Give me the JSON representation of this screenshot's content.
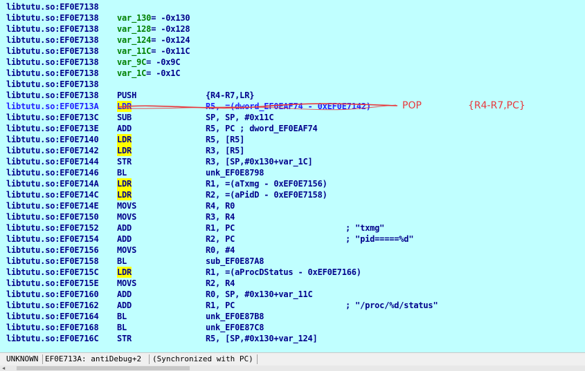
{
  "listing": {
    "rows": [
      {
        "kind": "plain",
        "addr": "libtutu.so:EF0E7138"
      },
      {
        "kind": "decl",
        "addr": "libtutu.so:EF0E7138",
        "var": "var_130",
        "val": "-0x130"
      },
      {
        "kind": "decl",
        "addr": "libtutu.so:EF0E7138",
        "var": "var_128",
        "val": "-0x128"
      },
      {
        "kind": "decl",
        "addr": "libtutu.so:EF0E7138",
        "var": "var_124",
        "val": "-0x124"
      },
      {
        "kind": "decl",
        "addr": "libtutu.so:EF0E7138",
        "var": "var_11C",
        "val": "-0x11C"
      },
      {
        "kind": "decl",
        "addr": "libtutu.so:EF0E7138",
        "var": "var_9C",
        "val": "-0x9C"
      },
      {
        "kind": "decl",
        "addr": "libtutu.so:EF0E7138",
        "var": "var_1C",
        "val": "-0x1C"
      },
      {
        "kind": "plain",
        "addr": "libtutu.so:EF0E7138"
      },
      {
        "kind": "ins",
        "addr": "libtutu.so:EF0E7138",
        "mn": "PUSH",
        "op": "{R4-R7,LR}"
      },
      {
        "kind": "ins",
        "addr": "libtutu.so:EF0E713A",
        "mn": "LDR",
        "op": "R5, =(dword_EF0EAF74 - 0xEF0E7142)",
        "current": true,
        "struck": true
      },
      {
        "kind": "ins",
        "addr": "libtutu.so:EF0E713C",
        "mn": "SUB",
        "op": "SP, SP, #0x11C"
      },
      {
        "kind": "ins",
        "addr": "libtutu.so:EF0E713E",
        "mn": "ADD",
        "op": "R5, PC ; dword_EF0EAF74"
      },
      {
        "kind": "ins",
        "addr": "libtutu.so:EF0E7140",
        "mn": "LDR",
        "op": "R5, [R5]"
      },
      {
        "kind": "ins",
        "addr": "libtutu.so:EF0E7142",
        "mn": "LDR",
        "op": "R3, [R5]"
      },
      {
        "kind": "ins",
        "addr": "libtutu.so:EF0E7144",
        "mn": "STR",
        "op": "R3, [SP,#0x130+var_1C]"
      },
      {
        "kind": "ins",
        "addr": "libtutu.so:EF0E7146",
        "mn": "BL",
        "op": "unk_EF0E8798"
      },
      {
        "kind": "ins",
        "addr": "libtutu.so:EF0E714A",
        "mn": "LDR",
        "op": "R1, =(aTxmg - 0xEF0E7156)"
      },
      {
        "kind": "ins",
        "addr": "libtutu.so:EF0E714C",
        "mn": "LDR",
        "op": "R2, =(aPidD - 0xEF0E7158)"
      },
      {
        "kind": "ins",
        "addr": "libtutu.so:EF0E714E",
        "mn": "MOVS",
        "op": "R4, R0"
      },
      {
        "kind": "ins",
        "addr": "libtutu.so:EF0E7150",
        "mn": "MOVS",
        "op": "R3, R4"
      },
      {
        "kind": "ins",
        "addr": "libtutu.so:EF0E7152",
        "mn": "ADD",
        "op": "R1, PC",
        "cm": "; \"txmg\""
      },
      {
        "kind": "ins",
        "addr": "libtutu.so:EF0E7154",
        "mn": "ADD",
        "op": "R2, PC",
        "cm": "; \"pid=====%d\""
      },
      {
        "kind": "ins",
        "addr": "libtutu.so:EF0E7156",
        "mn": "MOVS",
        "op": "R0, #4"
      },
      {
        "kind": "ins",
        "addr": "libtutu.so:EF0E7158",
        "mn": "BL",
        "op": "sub_EF0E87A8"
      },
      {
        "kind": "ins",
        "addr": "libtutu.so:EF0E715C",
        "mn": "LDR",
        "op": "R1, =(aProcDStatus - 0xEF0E7166)"
      },
      {
        "kind": "ins",
        "addr": "libtutu.so:EF0E715E",
        "mn": "MOVS",
        "op": "R2, R4"
      },
      {
        "kind": "ins",
        "addr": "libtutu.so:EF0E7160",
        "mn": "ADD",
        "op": "R0, SP, #0x130+var_11C"
      },
      {
        "kind": "ins",
        "addr": "libtutu.so:EF0E7162",
        "mn": "ADD",
        "op": "R1, PC",
        "cm": "; \"/proc/%d/status\""
      },
      {
        "kind": "ins",
        "addr": "libtutu.so:EF0E7164",
        "mn": "BL",
        "op": "unk_EF0E87B8"
      },
      {
        "kind": "ins",
        "addr": "libtutu.so:EF0E7168",
        "mn": "BL",
        "op": "unk_EF0E87C8"
      },
      {
        "kind": "ins",
        "addr": "libtutu.so:EF0E716C",
        "mn": "STR",
        "op": "R5, [SP,#0x130+var_124]"
      }
    ],
    "highlight_mnemonic": "LDR",
    "colors": {
      "background": "#c0ffff",
      "text": "#00008b",
      "current_line": "#2020ff",
      "variable": "#008000",
      "highlight": "#ffff00",
      "annotation": "#e8383c"
    }
  },
  "annotation": {
    "pop_label": "POP",
    "regs_label": "{R4-R7,PC}"
  },
  "statusbar": {
    "segment": "UNKNOWN",
    "location": "EF0E713A: antiDebug+2",
    "sync": "(Synchronized with PC)"
  }
}
